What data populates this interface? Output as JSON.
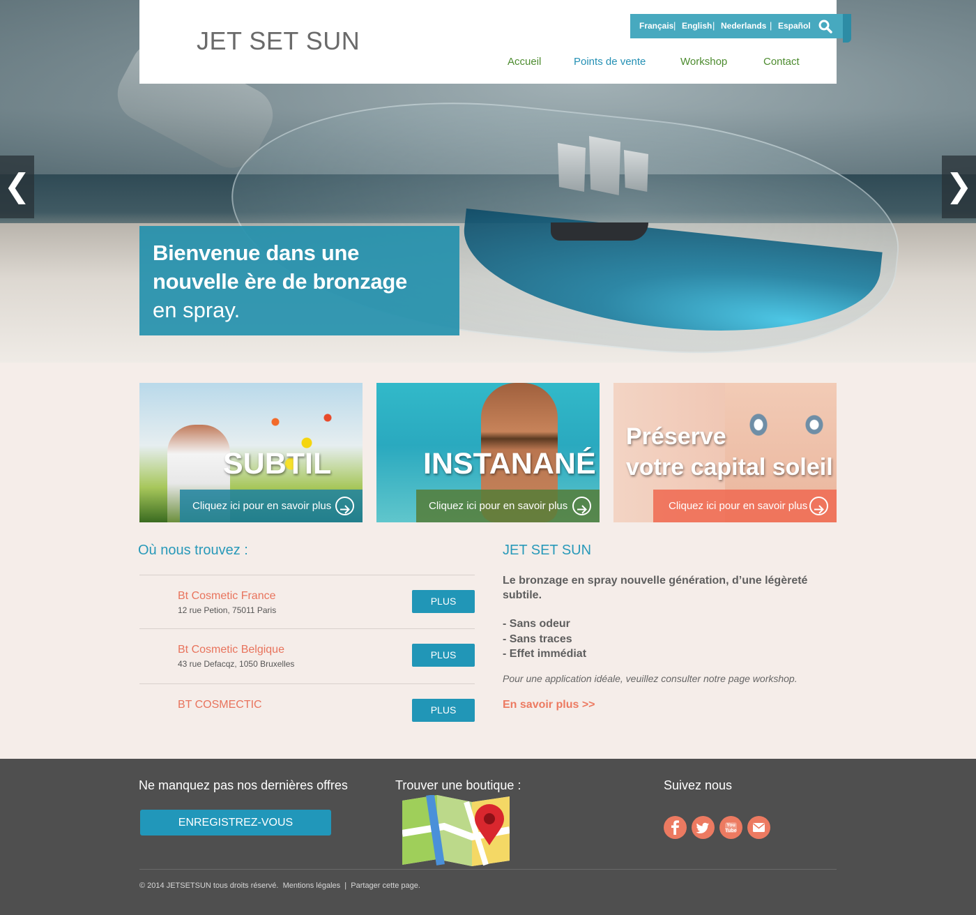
{
  "header": {
    "logo": "JET SET SUN",
    "languages": [
      "Français",
      "English",
      "Nederlands",
      "Español"
    ],
    "nav": [
      "Accueil",
      "Points de vente",
      "Workshop",
      "Contact"
    ],
    "active_nav": "Points de vente"
  },
  "hero": {
    "caption_line1": "Bienvenue dans une",
    "caption_line2": "nouvelle ère de bronzage",
    "caption_line3": "en spray.",
    "prev_arrow": "❮",
    "next_arrow": "❯"
  },
  "cards": [
    {
      "title": "SUBTIL",
      "cta": "Cliquez ici pour en savoir plus"
    },
    {
      "title": "INSTANANÉ",
      "cta": "Cliquez ici pour en savoir plus"
    },
    {
      "title_line1": "Préserve",
      "title_line2": "votre capital soleil",
      "cta": "Cliquez ici pour en savoir plus"
    }
  ],
  "locations": {
    "title": "Où nous trouvez :",
    "items": [
      {
        "name": "Bt Cosmetic France",
        "address": "12 rue Petion, 75011 Paris",
        "button": "PLUS"
      },
      {
        "name": "Bt Cosmetic Belgique",
        "address": "43 rue Defacqz, 1050 Bruxelles",
        "button": "PLUS"
      },
      {
        "name": "BT COSMECTIC",
        "address": "",
        "button": "PLUS"
      }
    ]
  },
  "about": {
    "title": "JET SET SUN",
    "intro": "Le bronzage en spray nouvelle génération, d’une légèreté subtile.",
    "list": [
      "- Sans odeur",
      "- Sans traces",
      "- Effet immédiat"
    ],
    "note": "Pour une application idéale, veuillez consulter notre page workshop.",
    "more": "En savoir plus >>"
  },
  "footer": {
    "offers_title": "Ne manquez pas nos dernières offres",
    "register_button": "ENREGISTREZ-VOUS",
    "store_title": "Trouver une boutique :",
    "follow_title": "Suivez nous",
    "social": [
      "facebook-icon",
      "twitter-icon",
      "youtube-icon",
      "mail-icon"
    ],
    "youtube_text": "You Tube",
    "copyright": "© 2014 JETSETSUN tous droits réservé.",
    "legal_link": "Mentions légales",
    "share_link": "Partager cette page."
  },
  "colors": {
    "accent_blue": "#2196b7",
    "coral": "#ec7a61",
    "green": "#4c8b2e",
    "footer_bg": "#4f4f4f"
  }
}
